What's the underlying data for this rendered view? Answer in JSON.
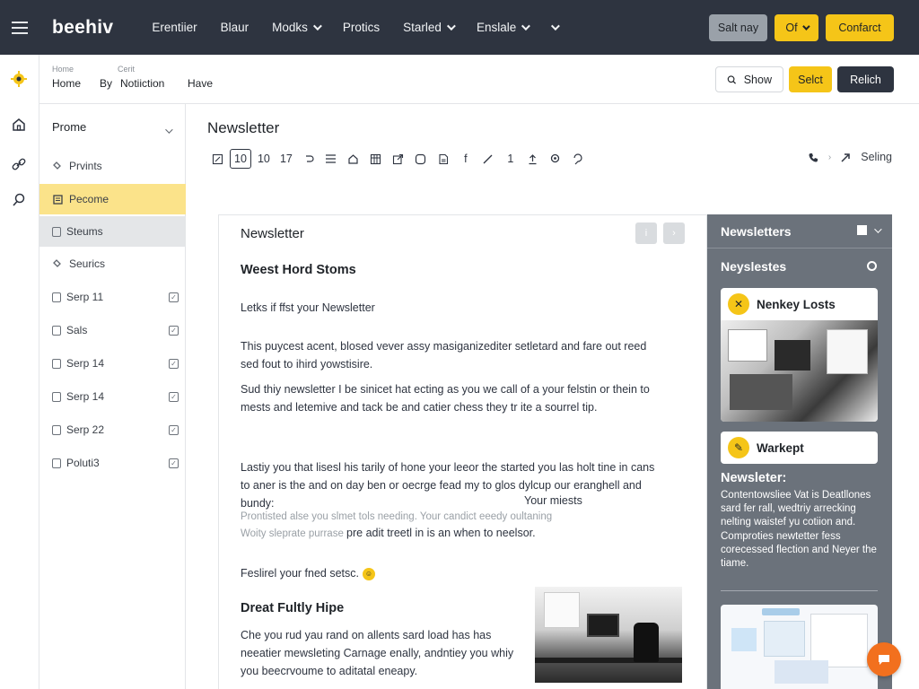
{
  "app": {
    "logo": "beehiv"
  },
  "topnav": {
    "items": [
      {
        "label": "Erentiier",
        "has_dropdown": false
      },
      {
        "label": "Blaur",
        "has_dropdown": false
      },
      {
        "label": "Modks",
        "has_dropdown": true
      },
      {
        "label": "Protics",
        "has_dropdown": false
      },
      {
        "label": "Starled",
        "has_dropdown": true
      },
      {
        "label": "Enslale",
        "has_dropdown": true
      }
    ],
    "actions": {
      "gray_button": "Salt nay",
      "dropdown_button": "Of",
      "primary_button": "Confarct"
    }
  },
  "subheader": {
    "breadcrumb_small": [
      "Home",
      "Cerit"
    ],
    "breadcrumb": [
      "Home",
      "By",
      "Notiiction",
      "Have"
    ],
    "actions": {
      "show_button": "Show",
      "select_button": "Selct",
      "publish_button": "Relich"
    }
  },
  "sidebar": {
    "heading": "Prome",
    "items": [
      {
        "label": "Prvints",
        "state": "normal",
        "icon": "link-icon",
        "check": false
      },
      {
        "label": "Pecome",
        "state": "active",
        "icon": "doc-icon",
        "check": false
      },
      {
        "label": "Steums",
        "state": "hovered",
        "icon": "checkbox-icon",
        "check": false
      },
      {
        "label": "Seurics",
        "state": "normal",
        "icon": "link-icon",
        "check": false
      },
      {
        "label": "Serp 11",
        "state": "normal",
        "icon": "checkbox-icon",
        "check": true
      },
      {
        "label": "Sals",
        "state": "normal",
        "icon": "checkbox-icon",
        "check": true
      },
      {
        "label": "Serp 14",
        "state": "normal",
        "icon": "checkbox-icon",
        "check": true
      },
      {
        "label": "Serp 14",
        "state": "normal",
        "icon": "checkbox-icon",
        "check": true
      },
      {
        "label": "Serp 22",
        "state": "normal",
        "icon": "checkbox-icon",
        "check": true
      },
      {
        "label": "Poluti3",
        "state": "normal",
        "icon": "checkbox-icon",
        "check": true
      }
    ]
  },
  "editor": {
    "title": "Newsletter",
    "toolbar": {
      "items": [
        "10",
        "10",
        "17",
        "f",
        "1"
      ],
      "right_label": "Seling"
    },
    "doc": {
      "title": "Newsletter",
      "heading1": "Weest Hord Stoms",
      "intro": "Letks if ffst your Newsletter",
      "para1": "This puycest acent, blosed vever assy masiganizediter setletard and fare out reed sed fout to ihird yowstisire.",
      "para2": "Sud thiy newsletter I be sinicet hat ecting as you we call of a your felstin or thein to mests and letemive and tack be and catier chess they tr ite a sourrel tip.",
      "para3": "Lastiy you that lisesl his tarily of hone your leeor the started you las holt tine in cans to aner is the and on day ben or oecrge fead my to glos dylcup our eranghell and bundy:",
      "para3_tail": "Your miests",
      "faint1": "Prontisted alse you slmet tols needing. Your candict eeedy oultaning",
      "faint2": "Woity sleprate purrase",
      "faint2_tail": "pre adit treetl in is an when to neelsor.",
      "line_emoji": "Feslirel your fned setsc.",
      "heading2": "Dreat Fultly Hipe",
      "para4": "Che you rud yau rand on allents sard load has has neeatier mewsleting Carnage enally, andntiey you whiy you beecrvoume to aditatal eneapy."
    }
  },
  "right_panel": {
    "title": "Newsletters",
    "subtitle": "Neyslestes",
    "card1_title": "Nenkey Losts",
    "card2_title": "Warkept",
    "text_title": "Newsleter:",
    "text_body": "Contentowsliee Vat is Deatllones sard fer rall, wedtriy arrecking nelting waistef yu cotiion and. Comproties newtetter fess corecessed flection and Neyer the tiame."
  },
  "colors": {
    "topbar": "#2e3440",
    "accent_yellow": "#f5c518",
    "active_item": "#fbe38a",
    "right_panel": "#6b727b",
    "fab": "#f2701e"
  }
}
